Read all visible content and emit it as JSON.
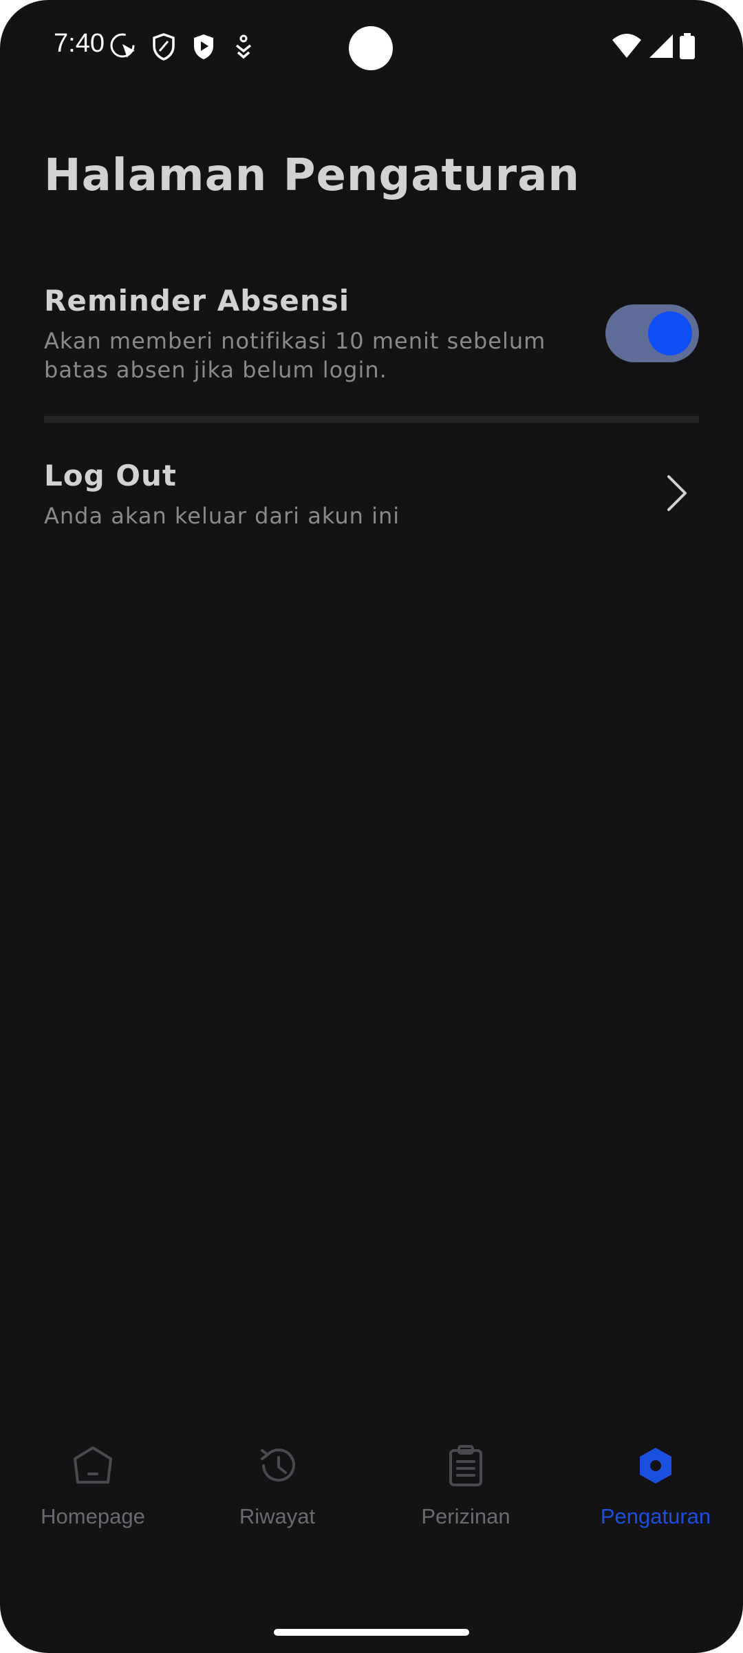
{
  "status_bar": {
    "time": "7:40",
    "left_icons": [
      "cursor-circle-icon",
      "shield-outline-icon",
      "shield-play-icon",
      "download-arrow-icon"
    ],
    "right_icons": [
      "wifi-icon",
      "signal-icon",
      "battery-icon"
    ]
  },
  "page": {
    "title": "Halaman Pengaturan"
  },
  "settings": {
    "reminder": {
      "title": "Reminder Absensi",
      "description": "Akan memberi notifikasi 10 menit sebelum batas absen jika belum login.",
      "enabled": true
    },
    "logout": {
      "title": "Log Out",
      "description": "Anda akan keluar dari akun ini"
    }
  },
  "bottom_nav": {
    "items": [
      {
        "label": "Homepage",
        "icon": "home-icon",
        "active": false
      },
      {
        "label": "Riwayat",
        "icon": "history-icon",
        "active": false
      },
      {
        "label": "Perizinan",
        "icon": "clipboard-icon",
        "active": false
      },
      {
        "label": "Pengaturan",
        "icon": "settings-hexagon-icon",
        "active": true
      }
    ]
  },
  "colors": {
    "background": "#131315",
    "text_primary": "#d2d2d2",
    "text_secondary": "#8a8a8a",
    "accent": "#0f4ff5",
    "toggle_track": "#5f6d99",
    "nav_inactive": "#6b6b6f",
    "nav_active": "#1a4fe0"
  }
}
